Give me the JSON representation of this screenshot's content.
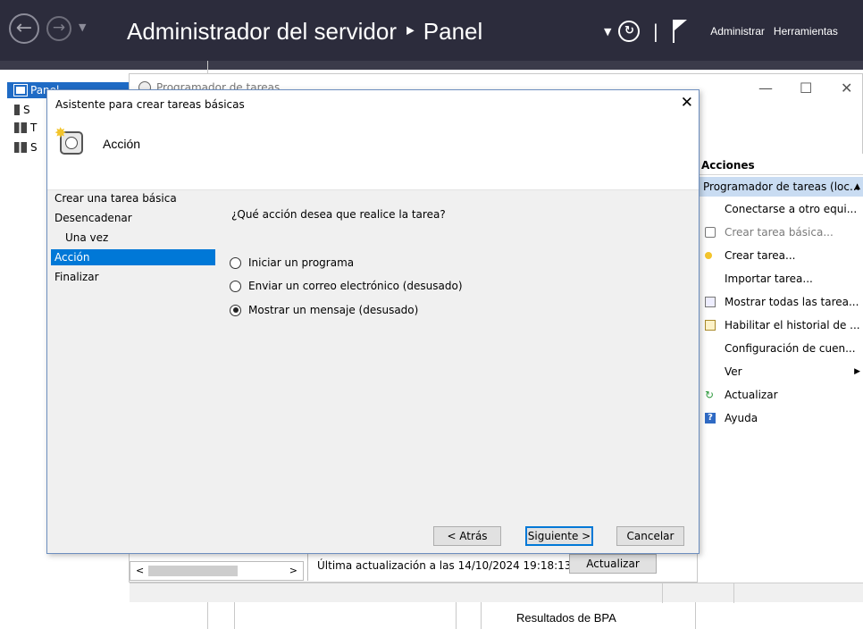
{
  "server_manager": {
    "title": "Administrador del servidor ‣ Panel",
    "menu_manage": "Administrar",
    "menu_tools": "Herramientas",
    "sidebar": [
      {
        "label": "Panel"
      },
      {
        "label": "S"
      },
      {
        "label": "T"
      },
      {
        "label": "S"
      }
    ],
    "bpa_label": "Resultados de BPA"
  },
  "task_scheduler": {
    "title": "Programador de tareas",
    "actions_header": "Acciones",
    "actions_section": "Programador de tareas (loc...",
    "actions": [
      {
        "label": "Conectarse a otro equi...",
        "icon": "none",
        "enabled": true
      },
      {
        "label": "Crear tarea básica...",
        "icon": "create-basic-task-icon",
        "enabled": false
      },
      {
        "label": "Crear tarea...",
        "icon": "create-task-icon",
        "enabled": true
      },
      {
        "label": "Importar tarea...",
        "icon": "none",
        "enabled": true
      },
      {
        "label": "Mostrar todas las tarea...",
        "icon": "show-tasks-icon",
        "enabled": true
      },
      {
        "label": "Habilitar el historial de ...",
        "icon": "history-icon",
        "enabled": true
      },
      {
        "label": "Configuración de cuen...",
        "icon": "none",
        "enabled": true
      },
      {
        "label": "Ver",
        "icon": "none",
        "enabled": true,
        "submenu": true
      },
      {
        "label": "Actualizar",
        "icon": "refresh-icon",
        "enabled": true
      },
      {
        "label": "Ayuda",
        "icon": "help-icon",
        "enabled": true
      }
    ],
    "last_update": "Última actualización a las 14/10/2024 19:18:13",
    "refresh_button": "Actualizar"
  },
  "wizard": {
    "title": "Asistente para crear tareas básicas",
    "step_title": "Acción",
    "steps": [
      {
        "label": "Crear una tarea básica",
        "sub": false,
        "active": false
      },
      {
        "label": "Desencadenar",
        "sub": false,
        "active": false
      },
      {
        "label": "Una vez",
        "sub": true,
        "active": false
      },
      {
        "label": "Acción",
        "sub": false,
        "active": true
      },
      {
        "label": "Finalizar",
        "sub": false,
        "active": false
      }
    ],
    "question": "¿Qué acción desea que realice la tarea?",
    "options": [
      {
        "label": "Iniciar un programa",
        "checked": false
      },
      {
        "label": "Enviar un correo electrónico (desusado)",
        "checked": false
      },
      {
        "label": "Mostrar un mensaje (desusado)",
        "checked": true
      }
    ],
    "buttons": {
      "back": "< Atrás",
      "next": "Siguiente >",
      "cancel": "Cancelar"
    }
  },
  "colors": {
    "header_bg": "#2c2c3c",
    "selection_blue": "#0078d7",
    "actions_section_bg": "#c9dcf2"
  }
}
